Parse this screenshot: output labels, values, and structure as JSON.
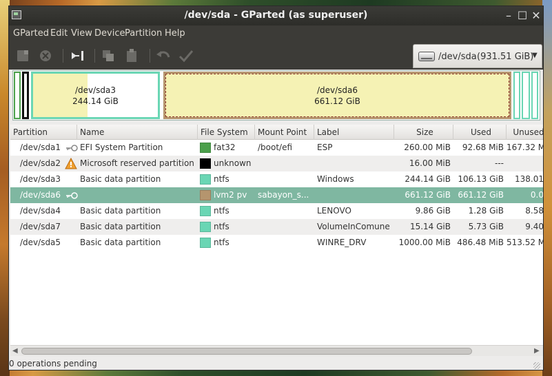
{
  "window": {
    "title": "/dev/sda - GParted (as superuser)"
  },
  "menu": [
    "GParted",
    "Edit",
    "View",
    "Device",
    "Partition",
    "Help"
  ],
  "toolbar": {
    "icons": [
      "new-partition-icon",
      "delete-icon",
      "resize-move-icon",
      "copy-icon",
      "paste-icon",
      "undo-icon",
      "apply-icon"
    ]
  },
  "device": {
    "name": "/dev/sda",
    "size": "(931.51 GiB)"
  },
  "visual": {
    "sda3": {
      "name": "/dev/sda3",
      "size": "244.14 GiB",
      "used_fraction": 0.4354
    },
    "sda6": {
      "name": "/dev/sda6",
      "size": "661.12 GiB"
    }
  },
  "columns": [
    "Partition",
    "Name",
    "File System",
    "Mount Point",
    "Label",
    "Size",
    "Used",
    "Unused"
  ],
  "rows": [
    {
      "partition": "/dev/sda1",
      "icon": "key-icon",
      "name": "EFI System Partition",
      "fs": "fat32",
      "fs_color": "#4ba04b",
      "mount": "/boot/efi",
      "label": "ESP",
      "size": "260.00 MiB",
      "used": "92.68 MiB",
      "unused": "167.32 M"
    },
    {
      "partition": "/dev/sda2",
      "icon": "warning-icon",
      "name": "Microsoft reserved partition",
      "fs": "unknown",
      "fs_color": "#000000",
      "mount": "",
      "label": "",
      "size": "16.00 MiB",
      "used": "---",
      "unused": ""
    },
    {
      "partition": "/dev/sda3",
      "icon": "",
      "name": "Basic data partition",
      "fs": "ntfs",
      "fs_color": "#6ad6b4",
      "mount": "",
      "label": "Windows",
      "size": "244.14 GiB",
      "used": "106.13 GiB",
      "unused": "138.01"
    },
    {
      "partition": "/dev/sda6",
      "icon": "key-icon",
      "name": "",
      "fs": "lvm2 pv",
      "fs_color": "#b5956e",
      "mount": "sabayon_s...",
      "label": "",
      "size": "661.12 GiB",
      "used": "661.12 GiB",
      "unused": "0.0"
    },
    {
      "partition": "/dev/sda4",
      "icon": "",
      "name": "Basic data partition",
      "fs": "ntfs",
      "fs_color": "#6ad6b4",
      "mount": "",
      "label": "LENOVO",
      "size": "9.86 GiB",
      "used": "1.28 GiB",
      "unused": "8.58"
    },
    {
      "partition": "/dev/sda7",
      "icon": "",
      "name": "Basic data partition",
      "fs": "ntfs",
      "fs_color": "#6ad6b4",
      "mount": "",
      "label": "VolumeInComune",
      "size": "15.14 GiB",
      "used": "5.73 GiB",
      "unused": "9.40"
    },
    {
      "partition": "/dev/sda5",
      "icon": "",
      "name": "Basic data partition",
      "fs": "ntfs",
      "fs_color": "#6ad6b4",
      "mount": "",
      "label": "WINRE_DRV",
      "size": "1000.00 MiB",
      "used": "486.48 MiB",
      "unused": "513.52 M"
    }
  ],
  "selected_row": 3,
  "status": "0 operations pending"
}
